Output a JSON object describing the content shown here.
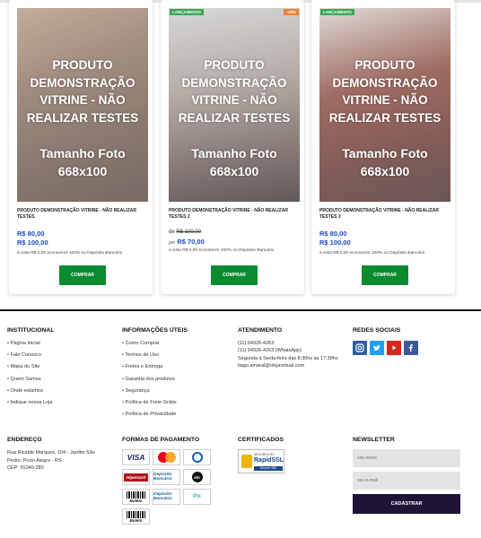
{
  "products": [
    {
      "badges": [],
      "image_text_1": "PRODUTO DEMONSTRAÇÃO VITRINE - NÃO REALIZAR TESTES",
      "image_text_2": "Tamanho Foto 668x100",
      "name": "PRODUTO DEMONSTRAÇÃO VITRINE - NÃO REALIZAR TESTES",
      "old_price": "",
      "por_label": "",
      "price": "R$ 80,00",
      "price2": "R$ 100,00",
      "vista": "à vista R$ 0,00 economize 100% no Depósito Bancário",
      "buy_label": "COMPRAR"
    },
    {
      "badges": [
        "LANÇAMENTO",
        "-30%"
      ],
      "image_text_1": "PRODUTO DEMONSTRAÇÃO VITRINE - NÃO REALIZAR TESTES",
      "image_text_2": "Tamanho Foto 668x100",
      "name": "PRODUTO DEMONSTRAÇÃO VITRINE - NÃO REALIZAR TESTES 2",
      "old_price_prefix": "de",
      "old_price": "R$ 100,00",
      "por_label": "por",
      "price": "R$ 70,00",
      "vista": "à vista R$ 0,00 economize 100% no Depósito Bancário",
      "buy_label": "COMPRAR"
    },
    {
      "badges": [
        "LANÇAMENTO"
      ],
      "image_text_1": "PRODUTO DEMONSTRAÇÃO VITRINE - NÃO REALIZAR TESTES",
      "image_text_2": "Tamanho Foto 668x100",
      "name": "PRODUTO DEMONSTRAÇÃO VITRINE - NÃO REALIZAR TESTES 3",
      "old_price": "",
      "por_label": "",
      "price": "R$ 80,00",
      "price2": "R$ 100,00",
      "vista": "à vista R$ 0,00 economize 100% no Depósito Bancário",
      "buy_label": "COMPRAR"
    }
  ],
  "footer": {
    "institucional": {
      "title": "INSTITUCIONAL",
      "links": [
        "Página Inicial",
        "Fale Conosco",
        "Mapa do Site",
        "Quem Somos",
        "Onde estamos",
        "Indique nossa Loja"
      ]
    },
    "informacoes": {
      "title": "INFORMAÇÕES ÚTEIS",
      "links": [
        "Como Comprar",
        "Termos de Uso",
        "Fretes e Entrega",
        "Garantia dos produtos",
        "Segurança",
        "Política de Frete Grátis",
        "Política de Privacidade"
      ]
    },
    "atendimento": {
      "title": "ATENDIMENTO",
      "phone": "(11) 94326-4263",
      "whatsapp": "(11) 94326-4263 (WhatsApp)",
      "hours": "Segunda à Sexta-feira das 8:30hs às 17:30hs",
      "email": "tiago.amaral@olojavirtual.com"
    },
    "redes": {
      "title": "REDES SOCIAIS",
      "icons": [
        "instagram-icon",
        "twitter-icon",
        "youtube-icon",
        "facebook-icon"
      ]
    },
    "endereco": {
      "title": "ENDEREÇO",
      "text": "Rua Ricalde Marques, 104 - Jardim São Pedro, Porto Alegre - RS",
      "cep": "CEP: 91040-280"
    },
    "pagamento": {
      "title": "FORMAS DE PAGAMENTO",
      "methods": [
        "VISA",
        "Mastercard",
        "Diners Club",
        "Hipercard",
        "Depósito Bancário",
        "elo",
        "Boleto",
        "Pix"
      ]
    },
    "certificados": {
      "title": "CERTIFICADOS",
      "seal_secured": "SECURED BY",
      "seal_brand": "RapidSSL",
      "seal_bar": "Secure Site"
    },
    "newsletter": {
      "title": "NEWSLETTER",
      "name_placeholder": "seu nome",
      "email_placeholder": "seu e-mail",
      "submit_label": "CADASTRAR"
    }
  },
  "colors": {
    "price_blue": "#1a47c8",
    "buy_green": "#0b8a2e",
    "newsletter_button": "#1f1336",
    "badge_green": "#3aa657",
    "badge_orange": "#e8833a"
  }
}
